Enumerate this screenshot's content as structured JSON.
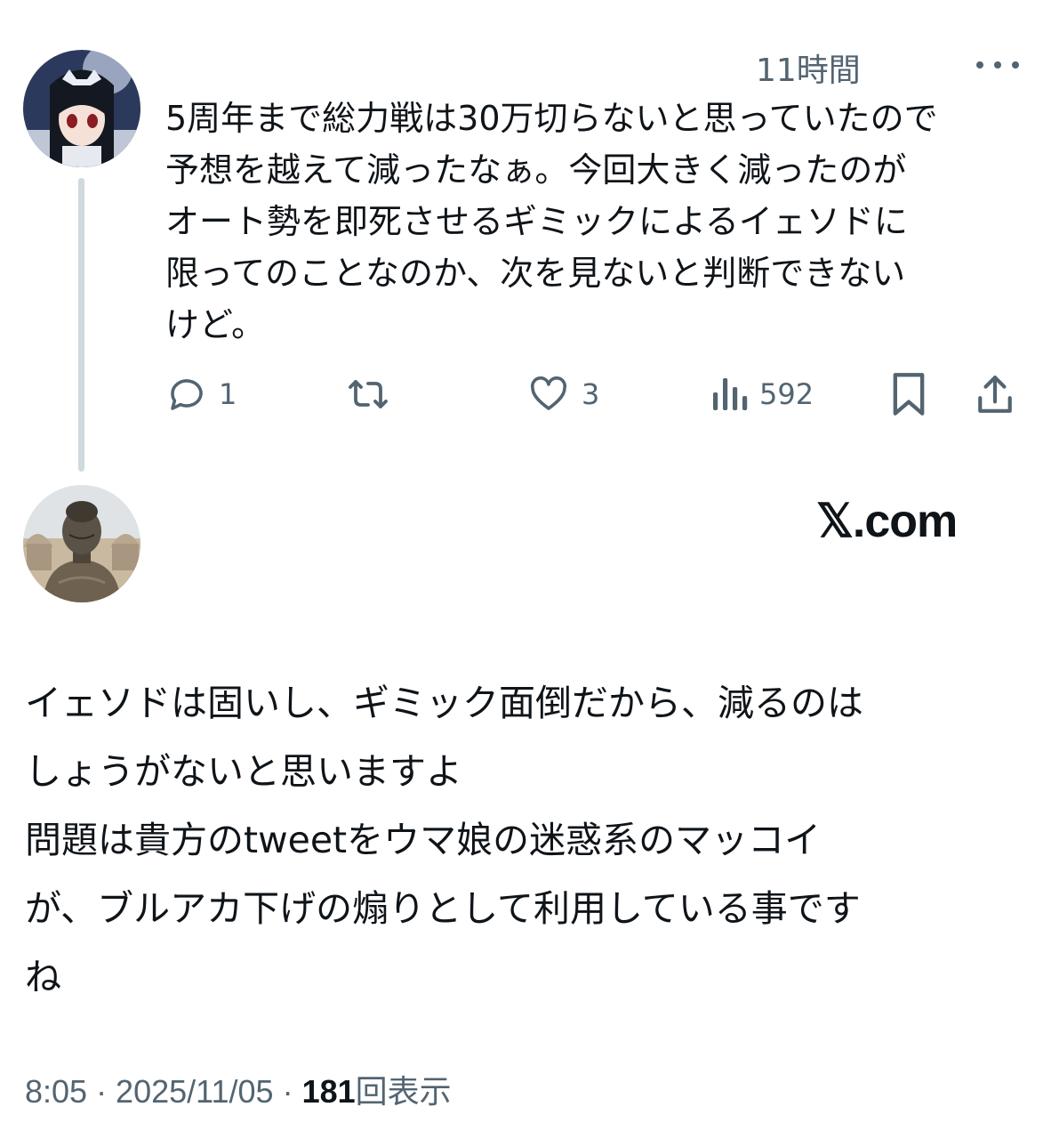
{
  "tweet": {
    "time": "11時間",
    "more_icon": "more-dots-icon",
    "text": "5周年まで総力戦は30万切らないと思っていたので\n予想を越えて減ったなぁ。今回大きく減ったのが\nオート勢を即死させるギミックによるイェソドに\n限ってのことなのか、次を見ないと判断できない\nけど。",
    "actions": {
      "reply_count": "1",
      "repost_count": "",
      "like_count": "3",
      "views_count": "592"
    }
  },
  "reply": {
    "brand": "𝕏.com",
    "text": "イェソドは固いし、ギミック面倒だから、減るのは\nしょうがないと思いますよ\n問題は貴方のtweetをウマ娘の迷惑系のマッコイ\nが、ブルアカ下げの煽りとして利用している事です\nね",
    "meta_time": "8:05 · 2025/11/05 · ",
    "views_count": "181",
    "views_label": "回表示"
  },
  "colors": {
    "text_primary": "#0f1419",
    "text_secondary": "#536471",
    "thread_line": "#cfd9de"
  }
}
